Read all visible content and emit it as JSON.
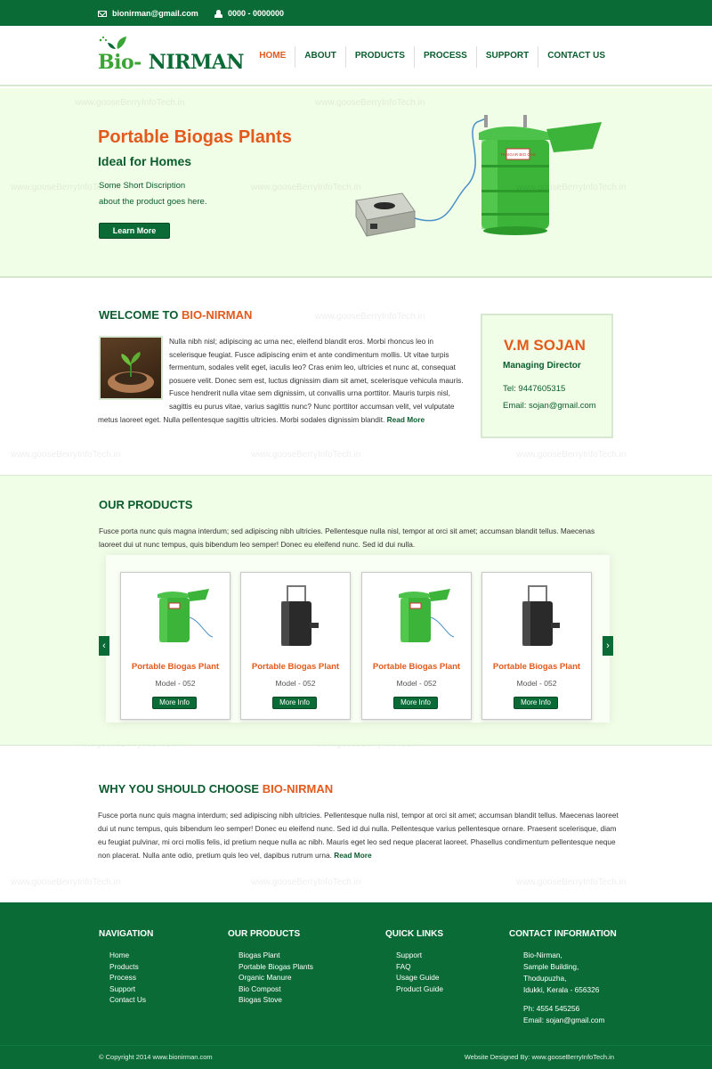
{
  "topbar": {
    "email": "bionirman@gmail.com",
    "phone": "0000 - 0000000"
  },
  "logo": {
    "part1": "Bio-",
    "part2": "NIRMAN"
  },
  "nav": [
    "HOME",
    "ABOUT",
    "PRODUCTS",
    "PROCESS",
    "SUPPORT",
    "CONTACT US"
  ],
  "hero": {
    "title": "Portable Biogas Plants",
    "subtitle": "Ideal for Homes",
    "desc1": "Some Short Discription",
    "desc2": "about the product goes here.",
    "button": "Learn More",
    "tank_label": "THAIGAR BIO GAS"
  },
  "watermark": "www.gooseBerryInfoTech.in",
  "welcome": {
    "title_a": "WELCOME TO ",
    "title_b": "BIO-NIRMAN",
    "text": "Nulla nibh nisl; adipiscing ac urna nec, eleifend blandit eros. Morbi rhoncus leo in scelerisque feugiat. Fusce adipiscing enim et ante condimentum mollis. Ut vitae turpis fermentum, sodales velit eget, iaculis leo? Cras enim leo, ultricies et nunc at, consequat posuere velit. Donec sem est, luctus dignissim diam sit amet, scelerisque vehicula mauris. Fusce hendrerit nulla vitae sem dignissim, ut convallis urna porttitor. Mauris turpis nisl, sagittis eu purus vitae, varius sagittis nunc? Nunc porttitor accumsan velit, vel vulputate metus laoreet eget. Nulla pellentesque sagittis ultricies. Morbi sodales dignissim blandit.",
    "read_more": "Read More"
  },
  "contact_card": {
    "name": "V.M SOJAN",
    "role": "Managing Director",
    "tel": "Tel: 9447605315",
    "email": "Email: sojan@gmail.com"
  },
  "products": {
    "title": "OUR PRODUCTS",
    "desc": "Fusce porta nunc quis magna interdum; sed adipiscing nibh ultricies. Pellentesque nulla nisl, tempor at orci sit amet; accumsan blandit tellus. Maecenas laoreet dui ut nunc tempus, quis bibendum leo semper! Donec eu eleifend nunc. Sed id dui nulla.",
    "prev": "‹",
    "next": "›",
    "items": [
      {
        "name": "Portable Biogas Plant",
        "model": "Model - 052",
        "button": "More Info",
        "color": "#3cb43a"
      },
      {
        "name": "Portable Biogas Plant",
        "model": "Model - 052",
        "button": "More Info",
        "color": "#2a2a2a"
      },
      {
        "name": "Portable Biogas Plant",
        "model": "Model - 052",
        "button": "More Info",
        "color": "#3cb43a"
      },
      {
        "name": "Portable Biogas Plant",
        "model": "Model - 052",
        "button": "More Info",
        "color": "#2a2a2a"
      }
    ]
  },
  "why": {
    "title_a": "WHY YOU SHOULD CHOOSE ",
    "title_b": "BIO-NIRMAN",
    "text": "Fusce porta nunc quis magna interdum; sed adipiscing nibh ultricies. Pellentesque nulla nisl, tempor at orci sit amet; accumsan blandit tellus. Maecenas laoreet dui ut nunc tempus, quis bibendum leo semper! Donec eu eleifend nunc. Sed id dui nulla. Pellentesque varius pellentesque ornare. Praesent scelerisque, diam eu feugiat pulvinar, mi orci mollis felis, id pretium neque nulla ac nibh. Mauris eget leo sed neque placerat laoreet. Phasellus condimentum pellentesque neque non placerat. Nulla ante odio, pretium quis leo vel, dapibus rutrum urna.",
    "read_more": "Read More"
  },
  "footer": {
    "navigation": {
      "title": "NAVIGATION",
      "items": [
        "Home",
        "Products",
        "Process",
        "Support",
        "Contact Us"
      ]
    },
    "our_products": {
      "title": "OUR PRODUCTS",
      "items": [
        "Biogas Plant",
        "Portable Biogas Plants",
        "Organic Manure",
        "Bio Compost",
        "Biogas Stove"
      ]
    },
    "quick_links": {
      "title": "QUICK LINKS",
      "items": [
        "Support",
        "FAQ",
        "Usage Guide",
        "Product Guide"
      ]
    },
    "contact": {
      "title": "CONTACT INFORMATION",
      "lines": [
        "Bio-Nirman,",
        "Sample Building,",
        "Thodupuzha,",
        "Idukki, Kerala - 656326"
      ],
      "phone": "Ph: 4554 545256",
      "email": "Email: sojan@gmail.com"
    },
    "copyright": "© Copyright 2014   www.bionirman.com",
    "designed_by": "Website Designed By: www.gooseBerryInfoTech.in"
  },
  "colors": {
    "brand_green": "#0b6b36",
    "accent_orange": "#e35a1c",
    "light_green_bg": "#f0fde7"
  }
}
